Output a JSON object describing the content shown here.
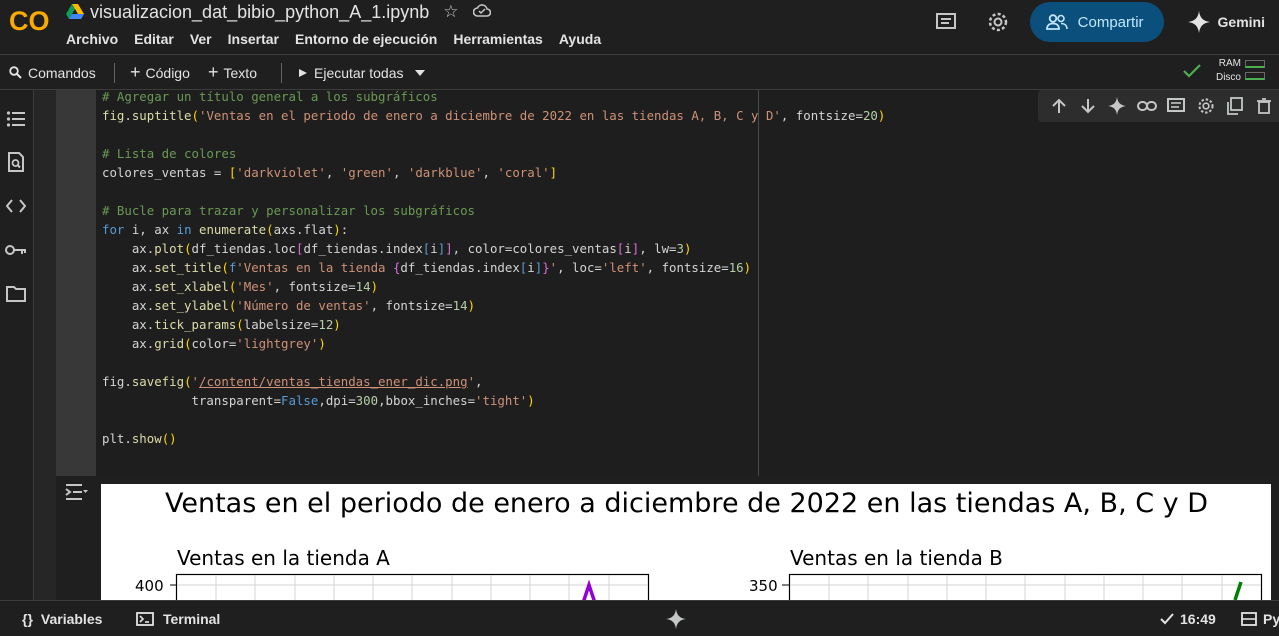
{
  "app": {
    "logo_text": "CO",
    "notebook_title": "visualizacion_dat_bibio_python_A_1.ipynb"
  },
  "menu": [
    "Archivo",
    "Editar",
    "Ver",
    "Insertar",
    "Entorno de ejecución",
    "Herramientas",
    "Ayuda"
  ],
  "header": {
    "share_label": "Compartir",
    "gemini_label": "Gemini"
  },
  "toolbar": {
    "commands_label": "Comandos",
    "code_label": "Código",
    "text_label": "Texto",
    "run_all_label": "Ejecutar todas",
    "ram_label": "RAM",
    "disk_label": "Disco"
  },
  "cell": {
    "code_lines": [
      "# Agregar un título general a los subgráficos",
      "fig.suptitle('Ventas en el periodo de enero a diciembre de 2022 en las tiendas A, B, C y D', fontsize=20)",
      "",
      "# Lista de colores",
      "colores_ventas = ['darkviolet', 'green', 'darkblue', 'coral']",
      "",
      "# Bucle para trazar y personalizar los subgráficos",
      "for i, ax in enumerate(axs.flat):",
      "    ax.plot(df_tiendas.loc[df_tiendas.index[i]], color=colores_ventas[i], lw=3)",
      "    ax.set_title(f'Ventas en la tienda {df_tiendas.index[i]}', loc='left', fontsize=16)",
      "    ax.set_xlabel('Mes', fontsize=14)",
      "    ax.set_ylabel('Número de ventas', fontsize=14)",
      "    ax.tick_params(labelsize=12)",
      "    ax.grid(color='lightgrey')",
      "",
      "fig.savefig('/content/ventas_tiendas_ener_dic.png',",
      "            transparent=False,dpi=300,bbox_inches='tight')",
      "",
      "plt.show()"
    ]
  },
  "output": {
    "suptitle": "Ventas en el periodo de enero a diciembre de 2022 en las tiendas A, B, C y D",
    "subplots": [
      {
        "title": "Ventas en la tienda A",
        "top_tick": "400",
        "line_color": "#9400d3"
      },
      {
        "title": "Ventas en la tienda B",
        "top_tick": "350",
        "line_color": "#008000"
      }
    ]
  },
  "statusbar": {
    "variables_label": "Variables",
    "terminal_label": "Terminal",
    "time": "16:49",
    "runtime_label": "Py"
  },
  "colors": {
    "accent_share": "#0b4f7c",
    "ok_green": "#4caf50",
    "logo_orange": "#f9ab00"
  }
}
